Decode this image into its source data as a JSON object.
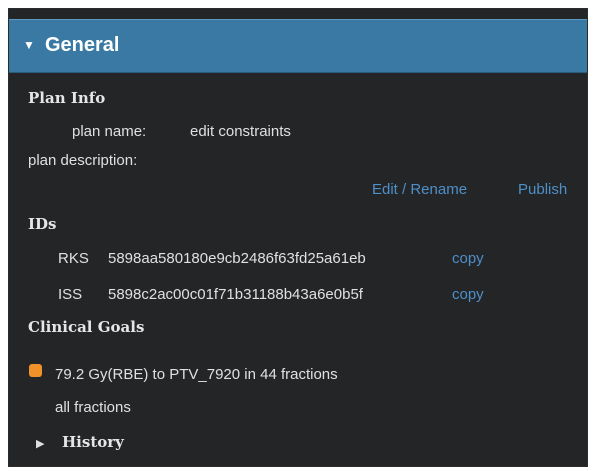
{
  "section": {
    "title": "General"
  },
  "plan_info": {
    "heading": "Plan Info",
    "name_label": "plan name:",
    "name_value": "edit constraints",
    "description_label": "plan description:",
    "edit_link": "Edit / Rename",
    "publish_link": "Publish"
  },
  "ids": {
    "heading": "IDs",
    "rows": [
      {
        "label": "RKS",
        "value": "5898aa580180e9cb2486f63fd25a61eb",
        "copy": "copy"
      },
      {
        "label": "ISS",
        "value": "5898c2ac00c01f71b31188b43a6e0b5f",
        "copy": "copy"
      }
    ]
  },
  "clinical_goals": {
    "heading": "Clinical Goals",
    "goal_color": "#f0922a",
    "goal_text": "79.2 Gy(RBE) to PTV_7920 in 44 fractions",
    "goal_sub": "all fractions"
  },
  "history": {
    "label": "History"
  },
  "colors": {
    "header": "#3a79a3",
    "panel": "#232527",
    "link": "#4f8fc8"
  }
}
